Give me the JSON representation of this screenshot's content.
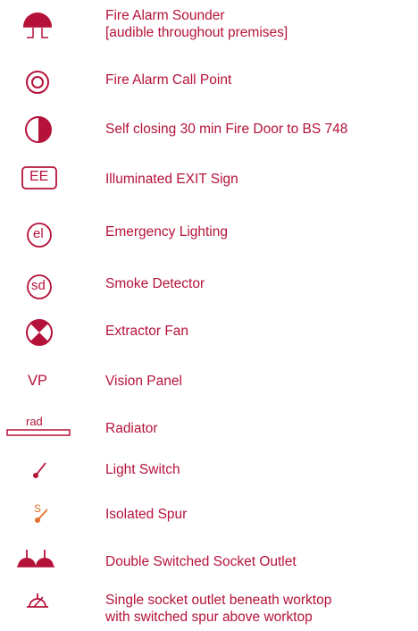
{
  "legend": {
    "items": [
      {
        "id": "sounder",
        "label_line1": "Fire Alarm Sounder",
        "label_line2": "[audible throughout premises]",
        "icon": "fire-alarm-sounder-icon"
      },
      {
        "id": "call-point",
        "label": "Fire Alarm Call Point",
        "icon": "fire-alarm-call-point-icon"
      },
      {
        "id": "fire-door",
        "label": "Self closing 30 min Fire Door to BS 748",
        "icon": "fire-door-icon"
      },
      {
        "id": "exit-sign",
        "label": "Illuminated EXIT Sign",
        "icon": "exit-sign-icon",
        "symbol_text": "EE"
      },
      {
        "id": "emergency-lighting",
        "label": "Emergency Lighting",
        "icon": "emergency-lighting-icon",
        "symbol_text": "el"
      },
      {
        "id": "smoke-detector",
        "label": "Smoke Detector",
        "icon": "smoke-detector-icon",
        "symbol_text": "sd"
      },
      {
        "id": "extractor-fan",
        "label": "Extractor Fan",
        "icon": "extractor-fan-icon"
      },
      {
        "id": "vision-panel",
        "label": "Vision Panel",
        "icon": "vision-panel-icon",
        "symbol_text": "VP"
      },
      {
        "id": "radiator",
        "label": "Radiator",
        "icon": "radiator-icon",
        "symbol_text": "rad"
      },
      {
        "id": "light-switch",
        "label": "Light Switch",
        "icon": "light-switch-icon"
      },
      {
        "id": "isolated-spur",
        "label": "Isolated Spur",
        "icon": "isolated-spur-icon",
        "symbol_text": "S"
      },
      {
        "id": "double-socket",
        "label": "Double Switched Socket Outlet",
        "icon": "double-socket-icon"
      },
      {
        "id": "single-socket",
        "label_line1": "Single socket outlet beneath worktop",
        "label_line2": "with switched spur above worktop",
        "icon": "single-socket-spur-icon"
      }
    ]
  },
  "colors": {
    "symbol": "#b5123a",
    "text": "#b5123a"
  }
}
